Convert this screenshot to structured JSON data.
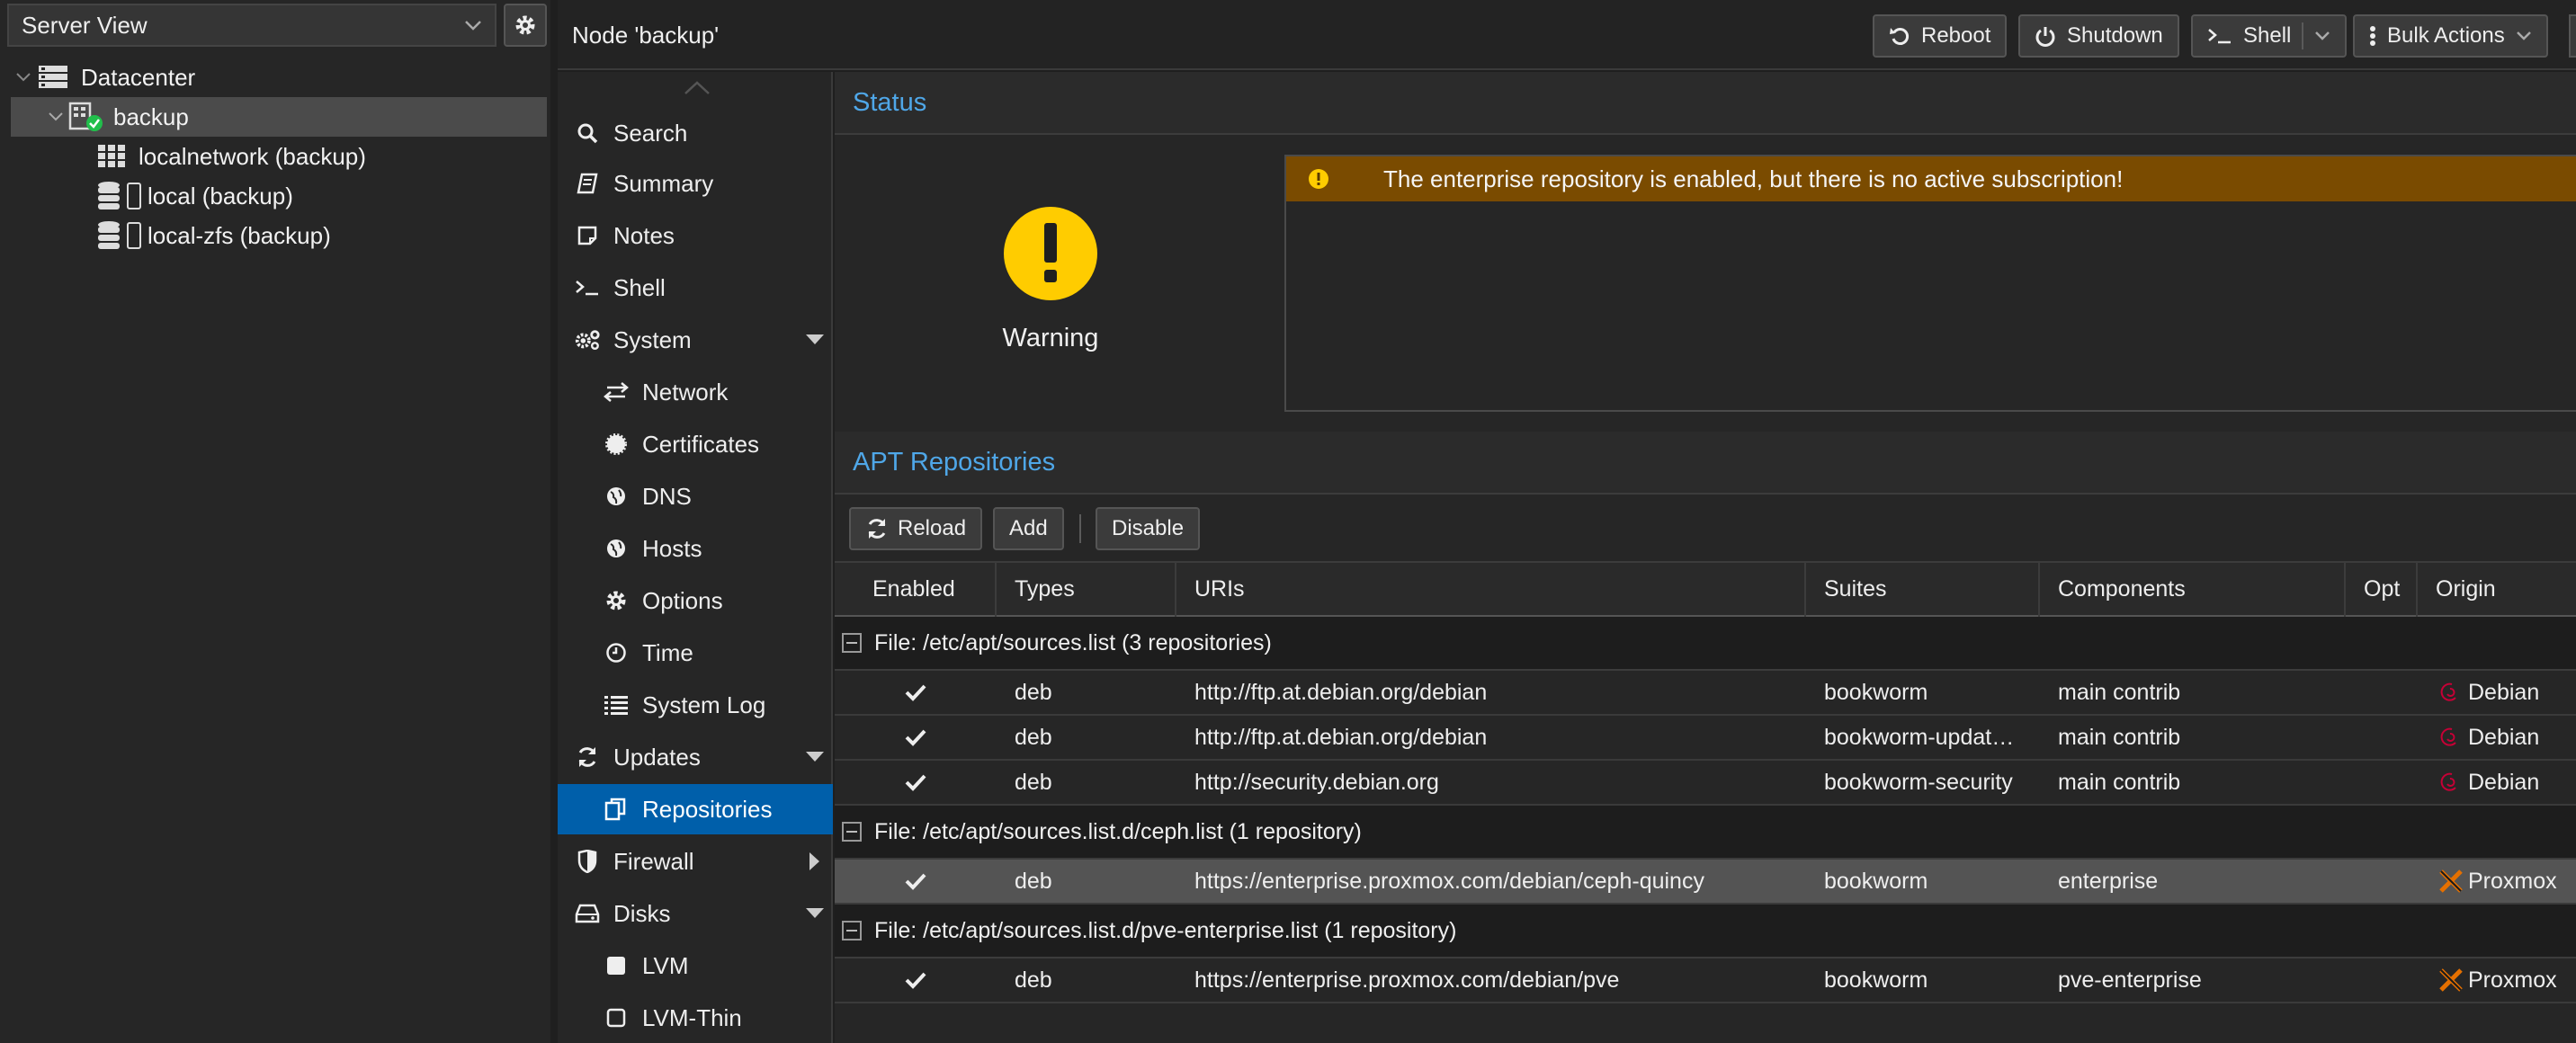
{
  "left": {
    "view_select": "Server View",
    "tree": [
      {
        "label": "Datacenter"
      },
      {
        "label": "backup"
      },
      {
        "label": "localnetwork (backup)"
      },
      {
        "label": "local (backup)"
      },
      {
        "label": "local-zfs (backup)"
      }
    ]
  },
  "header": {
    "title": "Node 'backup'",
    "reboot": "Reboot",
    "shutdown": "Shutdown",
    "shell": "Shell",
    "bulk": "Bulk Actions"
  },
  "nav": [
    {
      "label": "Search",
      "icon": "search-icon"
    },
    {
      "label": "Summary",
      "icon": "book-icon"
    },
    {
      "label": "Notes",
      "icon": "note-icon"
    },
    {
      "label": "Shell",
      "icon": "terminal-icon"
    },
    {
      "label": "System",
      "icon": "cogs-icon"
    },
    {
      "label": "Network",
      "icon": "exchange-icon"
    },
    {
      "label": "Certificates",
      "icon": "certificate-icon"
    },
    {
      "label": "DNS",
      "icon": "globe-icon"
    },
    {
      "label": "Hosts",
      "icon": "globe-icon"
    },
    {
      "label": "Options",
      "icon": "gear-icon"
    },
    {
      "label": "Time",
      "icon": "clock-icon"
    },
    {
      "label": "System Log",
      "icon": "list-icon"
    },
    {
      "label": "Updates",
      "icon": "refresh-icon"
    },
    {
      "label": "Repositories",
      "icon": "files-icon"
    },
    {
      "label": "Firewall",
      "icon": "shield-icon"
    },
    {
      "label": "Disks",
      "icon": "hdd-icon"
    },
    {
      "label": "LVM",
      "icon": "square-icon"
    },
    {
      "label": "LVM-Thin",
      "icon": "square-outline-icon"
    }
  ],
  "status": {
    "title": "Status",
    "warning_label": "Warning",
    "banner": "The enterprise repository is enabled, but there is no active subscription!"
  },
  "apt": {
    "title": "APT Repositories",
    "reload": "Reload",
    "add": "Add",
    "disable": "Disable",
    "columns": [
      "Enabled",
      "Types",
      "URIs",
      "Suites",
      "Components",
      "Opt",
      "Origin"
    ],
    "groups": [
      {
        "label": "File: /etc/apt/sources.list (3 repositories)",
        "rows": [
          {
            "type": "deb",
            "uri": "http://ftp.at.debian.org/debian",
            "suite": "bookworm",
            "components": "main contrib",
            "origin": "Debian"
          },
          {
            "type": "deb",
            "uri": "http://ftp.at.debian.org/debian",
            "suite": "bookworm-updat…",
            "components": "main contrib",
            "origin": "Debian"
          },
          {
            "type": "deb",
            "uri": "http://security.debian.org",
            "suite": "bookworm-security",
            "components": "main contrib",
            "origin": "Debian"
          }
        ]
      },
      {
        "label": "File: /etc/apt/sources.list.d/ceph.list (1 repository)",
        "rows": [
          {
            "type": "deb",
            "uri": "https://enterprise.proxmox.com/debian/ceph-quincy",
            "suite": "bookworm",
            "components": "enterprise",
            "origin": "Proxmox"
          }
        ]
      },
      {
        "label": "File: /etc/apt/sources.list.d/pve-enterprise.list (1 repository)",
        "rows": [
          {
            "type": "deb",
            "uri": "https://enterprise.proxmox.com/debian/pve",
            "suite": "bookworm",
            "components": "pve-enterprise",
            "origin": "Proxmox"
          }
        ]
      }
    ]
  },
  "colors": {
    "accent": "#005faa",
    "warning": "#ffcc00",
    "banner": "#7a4b00",
    "title": "#4fa7e8",
    "debian": "#c70036",
    "proxmox": "#e57000"
  }
}
